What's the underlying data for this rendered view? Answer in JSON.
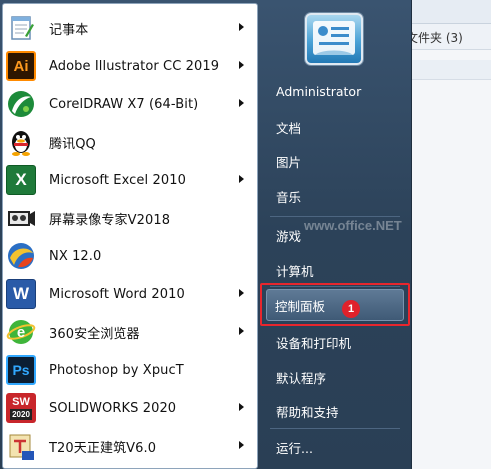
{
  "background_window": {
    "folder_count_text": "文件夹 (3)"
  },
  "programs": [
    {
      "name": "notepad",
      "label": "记事本",
      "icon": "notepad-icon",
      "submenu": true
    },
    {
      "name": "illustrator",
      "label": "Adobe Illustrator CC 2019",
      "icon": "illustrator-icon",
      "icon_text": "Ai",
      "submenu": true
    },
    {
      "name": "coreldraw",
      "label": "CorelDRAW X7 (64-Bit)",
      "icon": "coreldraw-icon",
      "submenu": true
    },
    {
      "name": "qq",
      "label": "腾讯QQ",
      "icon": "qq-penguin-icon",
      "submenu": false
    },
    {
      "name": "excel",
      "label": "Microsoft Excel 2010",
      "icon": "excel-icon",
      "icon_text": "X",
      "submenu": true
    },
    {
      "name": "screen-recorder",
      "label": "屏幕录像专家V2018",
      "icon": "screen-recorder-icon",
      "submenu": false
    },
    {
      "name": "nx",
      "label": "NX 12.0",
      "icon": "nx-icon",
      "submenu": false
    },
    {
      "name": "word",
      "label": "Microsoft Word 2010",
      "icon": "word-icon",
      "icon_text": "W",
      "submenu": true
    },
    {
      "name": "360-browser",
      "label": "360安全浏览器",
      "icon": "360-browser-icon",
      "icon_text": "e",
      "submenu": true
    },
    {
      "name": "photoshop",
      "label": "Photoshop by XpucT",
      "icon": "photoshop-icon",
      "icon_text": "Ps",
      "submenu": false
    },
    {
      "name": "solidworks",
      "label": "SOLIDWORKS 2020",
      "icon": "solidworks-icon",
      "icon_text": "SW",
      "icon_subtext": "2020",
      "submenu": true
    },
    {
      "name": "t20",
      "label": "T20天正建筑V6.0",
      "icon": "t20-icon",
      "submenu": true
    }
  ],
  "places": [
    {
      "name": "administrator",
      "label": "Administrator"
    },
    {
      "name": "documents",
      "label": "文档"
    },
    {
      "name": "pictures",
      "label": "图片"
    },
    {
      "name": "music",
      "label": "音乐"
    },
    {
      "name": "games",
      "label": "游戏"
    },
    {
      "name": "computer",
      "label": "计算机"
    },
    {
      "name": "control-panel",
      "label": "控制面板"
    },
    {
      "name": "devices-printers",
      "label": "设备和打印机"
    },
    {
      "name": "default-programs",
      "label": "默认程序"
    },
    {
      "name": "help-support",
      "label": "帮助和支持"
    },
    {
      "name": "run",
      "label": "运行..."
    }
  ],
  "annotation": {
    "step_number": "1"
  },
  "watermark_text": "www.office.NET",
  "colors": {
    "menu_dark": "#2c4259",
    "highlight_red": "#e8262d",
    "badge_red": "#e0222b"
  }
}
